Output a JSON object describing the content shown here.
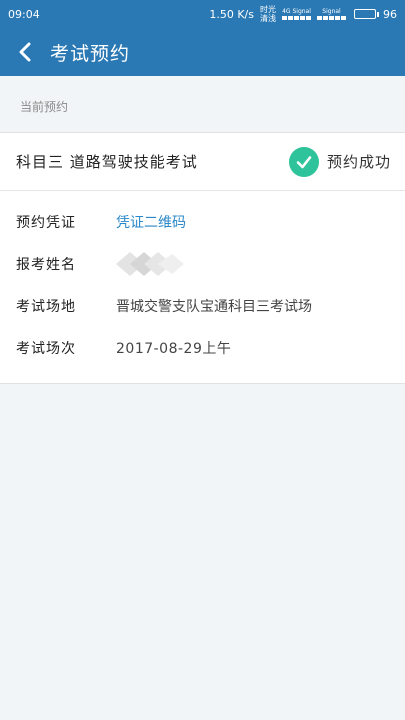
{
  "status_bar": {
    "time": "09:04",
    "speed": "1.50 K/s",
    "carrier_line1": "时光",
    "carrier_line2": "清浅",
    "signal1_label": "4G Signal",
    "signal2_label": "Signal",
    "battery_percent": "96",
    "battery_level": 0.96
  },
  "app_bar": {
    "back_icon": "back-arrow-icon",
    "title": "考试预约"
  },
  "section": {
    "label": "当前预约"
  },
  "booking": {
    "subject": "科目三 道路驾驶技能考试",
    "status_icon": "check-circle-icon",
    "status_color": "#2ec39a",
    "status": "预约成功",
    "fields": [
      {
        "key": "预约凭证",
        "value": "凭证二维码"
      },
      {
        "key": "报考姓名",
        "value": ""
      },
      {
        "key": "考试场地",
        "value": "晋城交警支队宝通科目三考试场"
      },
      {
        "key": "考试场次",
        "value": "2017-08-29上午"
      }
    ]
  },
  "colors": {
    "primary": "#2a79b4",
    "link": "#2a87c8",
    "success": "#2ec39a",
    "background": "#f1f5f7"
  }
}
